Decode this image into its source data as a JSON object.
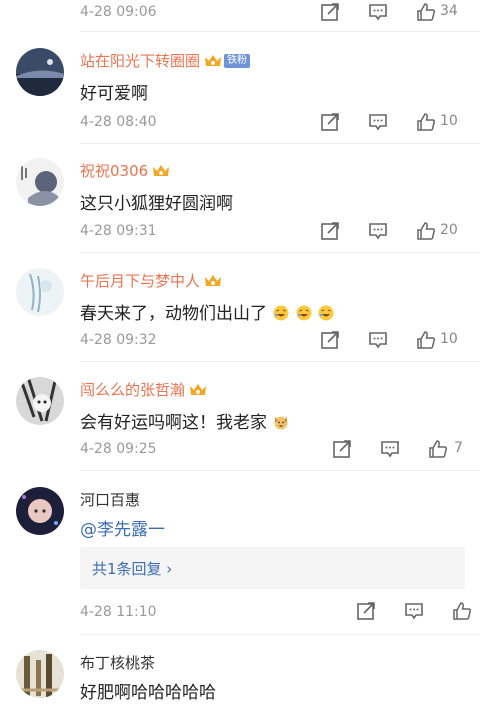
{
  "comments": [
    {
      "username": "",
      "badge": "",
      "content": "",
      "time": "4-28 09:06",
      "likes": "34"
    },
    {
      "username": "站在阳光下转圈圈",
      "badge": "铁粉",
      "content": "好可爱啊",
      "time": "4-28 08:40",
      "likes": "10"
    },
    {
      "username": "祝祝0306",
      "badge": "",
      "content": "这只小狐狸好圆润啊",
      "time": "4-28 09:31",
      "likes": "20"
    },
    {
      "username": "午后月下与梦中人",
      "badge": "",
      "content": "春天来了，动物们出山了",
      "time": "4-28 09:32",
      "likes": "10"
    },
    {
      "username": "闯么么的张哲瀚",
      "badge": "",
      "content": "会有好运吗啊这！我老家",
      "time": "4-28 09:25",
      "likes": "7"
    },
    {
      "username": "河口百惠",
      "badge": "",
      "content": "@李先露一",
      "time": "4-28 11:10",
      "likes": "",
      "reply_label": "共1条回复 ›"
    },
    {
      "username": "布丁核桃茶",
      "badge": "",
      "content": "好肥啊哈哈哈哈哈",
      "time": "",
      "likes": ""
    }
  ],
  "colors": {
    "vip_name": "#eb7350",
    "plain_name": "#333333",
    "mention": "#3d6db5",
    "fan_badge": "#6f93d8",
    "muted": "#999999"
  },
  "icons": [
    "share-icon",
    "comment-icon",
    "like-icon",
    "crown-icon",
    "emoji-laugh-icon",
    "emoji-dog-icon"
  ]
}
